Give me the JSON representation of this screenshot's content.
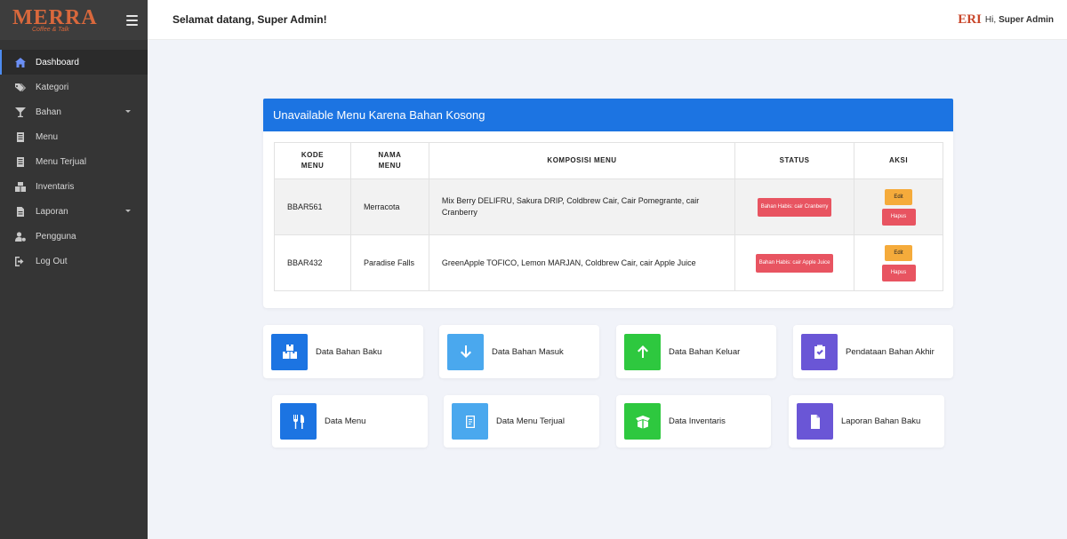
{
  "brand": {
    "logo_text": "MERRA",
    "logo_sub": "Coffee & Talk"
  },
  "sidebar": {
    "items": [
      {
        "label": "Dashboard",
        "icon": "home-icon",
        "active": true,
        "dropdown": false
      },
      {
        "label": "Kategori",
        "icon": "tags-icon",
        "active": false,
        "dropdown": false
      },
      {
        "label": "Bahan",
        "icon": "cocktail-icon",
        "active": false,
        "dropdown": true
      },
      {
        "label": "Menu",
        "icon": "document-icon",
        "active": false,
        "dropdown": false
      },
      {
        "label": "Menu Terjual",
        "icon": "document-icon",
        "active": false,
        "dropdown": false
      },
      {
        "label": "Inventaris",
        "icon": "boxes-icon",
        "active": false,
        "dropdown": false
      },
      {
        "label": "Laporan",
        "icon": "file-icon",
        "active": false,
        "dropdown": true
      },
      {
        "label": "Pengguna",
        "icon": "user-cog-icon",
        "active": false,
        "dropdown": false
      },
      {
        "label": "Log Out",
        "icon": "logout-icon",
        "active": false,
        "dropdown": false
      }
    ]
  },
  "header": {
    "welcome": "Selamat datang, Super Admin!",
    "user_logo": "ERI",
    "greeting": "Hi,",
    "user_name": "Super Admin"
  },
  "panel": {
    "title": "Unavailable Menu Karena Bahan Kosong",
    "columns": {
      "kode_line1": "KODE",
      "kode_line2": "MENU",
      "nama_line1": "NAMA",
      "nama_line2": "MENU",
      "komposisi": "KOMPOSISI MENU",
      "status": "STATUS",
      "aksi": "AKSI"
    },
    "rows": [
      {
        "kode": "BBAR561",
        "nama": "Merracota",
        "komposisi": "Mix Berry DELIFRU, Sakura DRIP, Coldbrew Cair, Cair Pomegrante, cair Cranberry",
        "status": "Bahan Habis: cair Cranberry",
        "edit": "Edit",
        "hapus": "Hapus"
      },
      {
        "kode": "BBAR432",
        "nama": "Paradise Falls",
        "komposisi": "GreenApple TOFICO, Lemon MARJAN, Coldbrew Cair, cair Apple Juice",
        "status": "Bahan Habis: cair Apple Juice",
        "edit": "Edit",
        "hapus": "Hapus"
      }
    ]
  },
  "cards": [
    {
      "label": "Data Bahan Baku",
      "icon": "boxes-icon",
      "color": "#1c74e2"
    },
    {
      "label": "Data Bahan Masuk",
      "icon": "arrow-down-icon",
      "color": "#4aa8ee"
    },
    {
      "label": "Data Bahan Keluar",
      "icon": "arrow-up-icon",
      "color": "#2ec83f"
    },
    {
      "label": "Pendataan Bahan Akhir",
      "icon": "clipboard-check-icon",
      "color": "#6a56d6"
    },
    {
      "label": "Data Menu",
      "icon": "utensils-icon",
      "color": "#1c74e2"
    },
    {
      "label": "Data Menu Terjual",
      "icon": "receipt-icon",
      "color": "#4aa8ee"
    },
    {
      "label": "Data Inventaris",
      "icon": "box-open-icon",
      "color": "#2ec83f"
    },
    {
      "label": "Laporan Bahan Baku",
      "icon": "file-icon",
      "color": "#6a56d6"
    }
  ]
}
